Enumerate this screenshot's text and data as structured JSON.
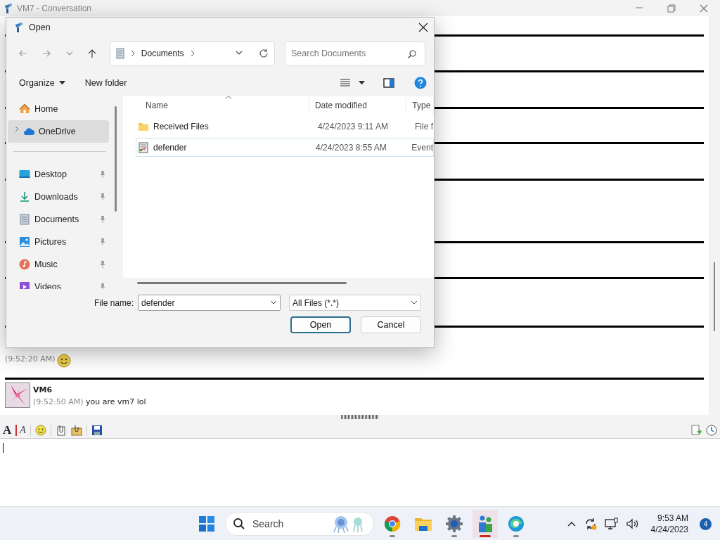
{
  "window": {
    "title": "VM7 - Conversation"
  },
  "format_tools": [
    "A",
    "A"
  ],
  "conversation": {
    "messages": [
      {
        "kind": "emote",
        "time": "(9:52:20 AM)"
      },
      {
        "kind": "message",
        "sender": "VM6",
        "time": "(9:52:50 AM)",
        "text": "you are vm7 lol"
      }
    ]
  },
  "dialog": {
    "title": "Open",
    "path": [
      "Documents"
    ],
    "search": {
      "placeholder": "Search Documents"
    },
    "commands": [
      "Organize",
      "New folder"
    ],
    "nav": [
      {
        "kind": "home",
        "label": "Home",
        "selected": false,
        "pinned": false
      },
      {
        "kind": "cloud",
        "label": "OneDrive",
        "selected": true,
        "pinned": false
      },
      {
        "kind": "desktop",
        "label": "Desktop",
        "selected": false,
        "pinned": true
      },
      {
        "kind": "downloads",
        "label": "Downloads",
        "selected": false,
        "pinned": true
      },
      {
        "kind": "documents",
        "label": "Documents",
        "selected": false,
        "pinned": true
      },
      {
        "kind": "pictures",
        "label": "Pictures",
        "selected": false,
        "pinned": true
      },
      {
        "kind": "music",
        "label": "Music",
        "selected": false,
        "pinned": true
      },
      {
        "kind": "videos",
        "label": "Videos",
        "selected": false,
        "pinned": true
      }
    ],
    "columns": [
      "Name",
      "Date modified",
      "Type"
    ],
    "files": [
      {
        "kind": "folder",
        "name": "Received Files",
        "date": "4/24/2023 9:11 AM",
        "type": "File f",
        "selected": false
      },
      {
        "kind": "log",
        "name": "defender",
        "date": "4/24/2023 8:55 AM",
        "type": "Event",
        "selected": true
      }
    ],
    "file_name_label": "File name:",
    "file_name": "defender",
    "file_type": "All Files (*.*)",
    "buttons": [
      "Open",
      "Cancel"
    ]
  },
  "taskbar": {
    "search_placeholder": "Search",
    "apps": [
      {
        "kind": "browser",
        "running": true,
        "active": false
      },
      {
        "kind": "folder",
        "running": false,
        "active": false
      },
      {
        "kind": "settings",
        "running": true,
        "active": false
      },
      {
        "kind": "messenger",
        "running": true,
        "active": true
      },
      {
        "kind": "edge",
        "running": true,
        "active": false
      }
    ],
    "time": "9:53 AM",
    "date": "4/24/2023",
    "notifications": "4"
  }
}
